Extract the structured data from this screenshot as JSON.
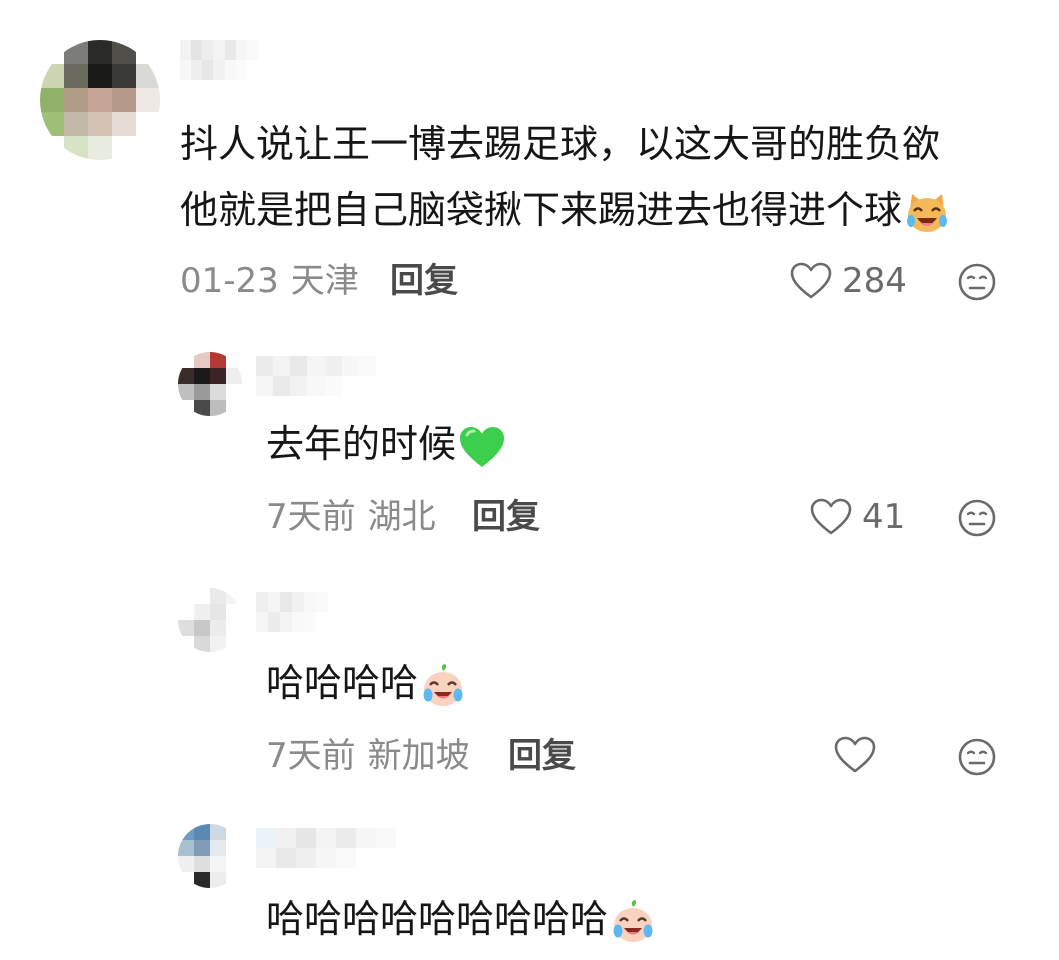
{
  "comments": [
    {
      "text_line1": "抖人说让王一博去踢足球，以这大哥的胜负欲",
      "text_line2": "他就是把自己脑袋揪下来踢进去也得进个球",
      "emoji": "laughing-cat-emoji",
      "time": "01-23",
      "location": "天津",
      "reply_label": "回复",
      "likes": "284"
    },
    {
      "text": "去年的时候",
      "emoji": "green-heart-emoji",
      "time": "7天前",
      "location": "湖北",
      "reply_label": "回复",
      "likes": "41"
    },
    {
      "text": "哈哈哈哈",
      "emoji": "crying-laughing-emoji",
      "time": "7天前",
      "location": "新加坡",
      "reply_label": "回复",
      "likes": ""
    },
    {
      "text": "哈哈哈哈哈哈哈哈哈",
      "emoji": "crying-laughing-emoji"
    }
  ],
  "icons": {
    "like": "heart-outline-icon",
    "dislike": "neutral-face-icon"
  },
  "colors": {
    "text": "#161616",
    "meta": "#8a8a8a",
    "reply": "#4a4a4a",
    "icon": "#6a6a6a",
    "green_heart": "#3ccf4e"
  }
}
